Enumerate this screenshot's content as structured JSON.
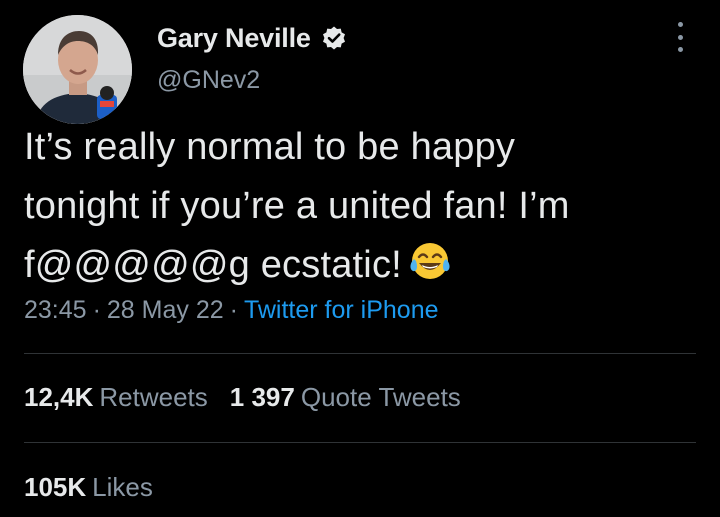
{
  "author": {
    "display_name": "Gary Neville",
    "handle": "@GNev2",
    "verified_icon": "verified-badge-icon"
  },
  "tweet": {
    "lines": [
      "It’s really normal to be happy",
      "tonight if you’re a united fan! I’m",
      "f@@@@@g ecstatic!"
    ],
    "emoji_icon": "face-with-tears-of-joy-icon"
  },
  "meta": {
    "time": "23:45",
    "separator": "·",
    "date": "28 May 22",
    "source": "Twitter for iPhone"
  },
  "stats": {
    "retweets_count": "12,4K",
    "retweets_label": "Retweets",
    "quote_count": "1 397",
    "quote_label": "Quote Tweets",
    "likes_count": "105K",
    "likes_label": "Likes"
  },
  "colors": {
    "background": "#000000",
    "primary_text": "#e7e9ea",
    "secondary_text": "#8b98a5",
    "link": "#1d9bf0",
    "divider": "#2f3336"
  }
}
